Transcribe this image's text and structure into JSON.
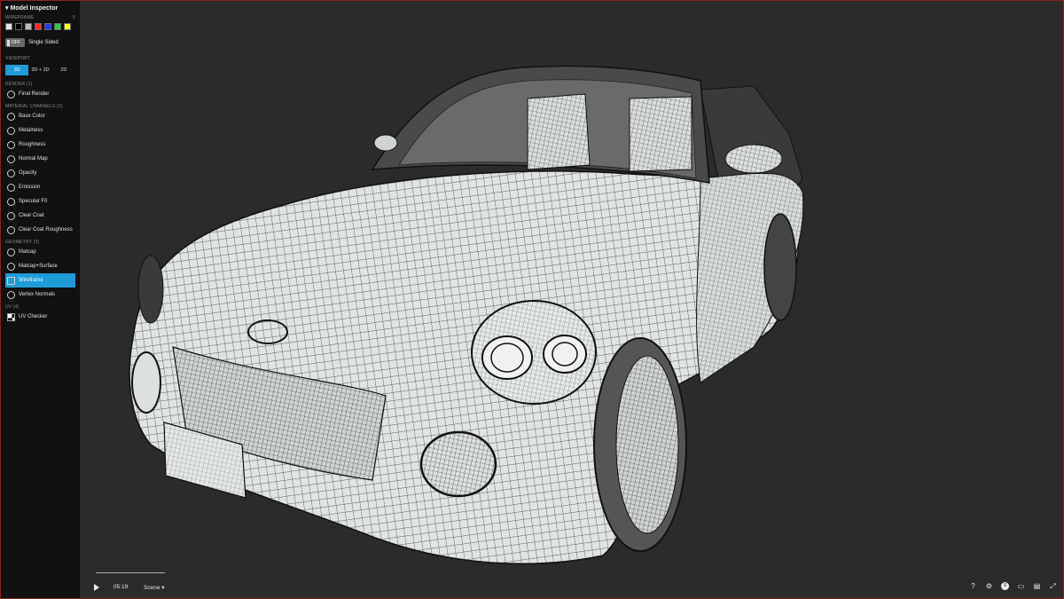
{
  "sidebar": {
    "title": "Model Inspector",
    "wireframe_label": "WIREFRAME",
    "wireframe_shortcut": "5",
    "swatches": [
      "#e6e6e6",
      "#000000",
      "#bdbdbd",
      "#ff2a2a",
      "#1f38ff",
      "#1fd13f",
      "#ffff2a"
    ],
    "toggle_state": "OFF",
    "toggle_label": "Single Sided",
    "viewport_label": "VIEWPORT",
    "viewport_options": [
      "3D",
      "3D + 2D",
      "2D"
    ],
    "viewport_selected": "3D",
    "render_label": "RENDER (1)",
    "render_items": [
      "Final Render"
    ],
    "material_label": "MATERIAL CHANNELS (2)",
    "material_items": [
      "Base Color",
      "Metalness",
      "Roughness",
      "Normal Map",
      "Opacity",
      "Emission",
      "Specular F0",
      "Clear Coat",
      "Clear Coat Roughness"
    ],
    "geometry_label": "GEOMETRY (3)",
    "geometry_items": [
      "Matcap",
      "Matcap+Surface",
      "Wireframe",
      "Vertex Normals"
    ],
    "geometry_selected": "Wireframe",
    "uv_label": "UV (4)",
    "uv_items": [
      "UV Checker"
    ]
  },
  "player": {
    "time": "05:19",
    "scene_label": "Scene"
  },
  "bottom_icons": [
    "help-icon",
    "settings-icon",
    "layers-icon",
    "vr-icon",
    "subtitles-icon",
    "fullscreen-icon"
  ],
  "colors": {
    "accent": "#1e9cd8",
    "background": "#2b2b2b",
    "sidebar": "#111111"
  }
}
